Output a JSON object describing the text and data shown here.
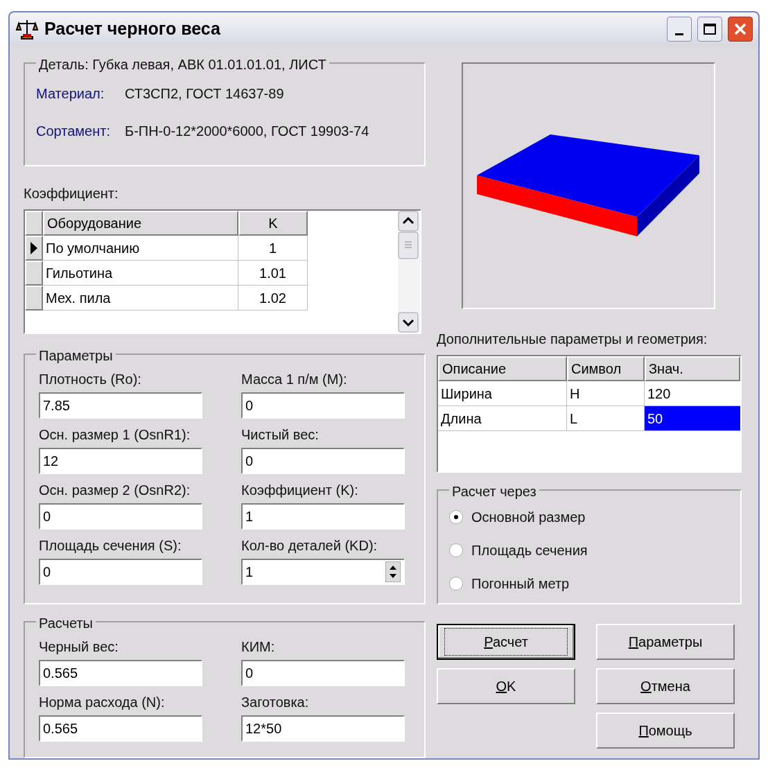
{
  "window": {
    "title": "Расчет черного веса"
  },
  "detail": {
    "legend": "Деталь: Губка левая, АВК 01.01.01.01, ЛИСТ",
    "rows": [
      {
        "label": "Материал:",
        "value": "СТ3СП2, ГОСТ 14637-89"
      },
      {
        "label": "Сортамент:",
        "value": "Б-ПН-0-12*2000*6000, ГОСТ 19903-74"
      }
    ]
  },
  "coefficient": {
    "label": "Коэффициент:",
    "columns": [
      "Оборудование",
      "K"
    ],
    "rows": [
      {
        "name": "По умолчанию",
        "k": "1",
        "selected": true
      },
      {
        "name": "Гильотина",
        "k": "1.01",
        "selected": false
      },
      {
        "name": "Мех. пила",
        "k": "1.02",
        "selected": false
      }
    ]
  },
  "parameters": {
    "legend": "Параметры",
    "fields": [
      {
        "label": "Плотность (Ro):",
        "value": "7.85",
        "kind": "text"
      },
      {
        "label": "Масса 1 п/м (M):",
        "value": "0",
        "kind": "text"
      },
      {
        "label": "Осн. размер 1 (OsnR1):",
        "value": "12",
        "kind": "text"
      },
      {
        "label": "Чистый вес:",
        "value": "0",
        "kind": "text"
      },
      {
        "label": "Осн. размер 2 (OsnR2):",
        "value": "0",
        "kind": "text"
      },
      {
        "label": "Коэффициент (K):",
        "value": "1",
        "kind": "text"
      },
      {
        "label": "Площадь сечения (S):",
        "value": "0",
        "kind": "text"
      },
      {
        "label": "Кол-во деталей (KD):",
        "value": "1",
        "kind": "spin"
      }
    ]
  },
  "calculations": {
    "legend": "Расчеты",
    "fields": [
      {
        "label": "Черный вес:",
        "value": "0.565",
        "kind": "text"
      },
      {
        "label": "КИМ:",
        "value": "0",
        "kind": "text"
      },
      {
        "label": "Норма расхода (N):",
        "value": "0.565",
        "kind": "text"
      },
      {
        "label": "Заготовка:",
        "value": "12*50",
        "kind": "text"
      }
    ]
  },
  "geometry": {
    "label": "Дополнительные параметры и геометрия:",
    "columns": [
      "Описание",
      "Символ",
      "Знач."
    ],
    "rows": [
      {
        "description": "Ширина",
        "symbol": "H",
        "value": "120",
        "selected": false
      },
      {
        "description": "Длина",
        "symbol": "L",
        "value": "50",
        "selected": true
      }
    ]
  },
  "calc_via": {
    "legend": "Расчет через",
    "options": [
      {
        "label": "Основной размер",
        "selected": true
      },
      {
        "label": "Площадь сечения",
        "selected": false
      },
      {
        "label": "Погонный метр",
        "selected": false
      }
    ]
  },
  "buttons": [
    {
      "label": "Расчет",
      "focused": true
    },
    {
      "label": "Параметры",
      "focused": false
    },
    {
      "label": "OK",
      "focused": false
    },
    {
      "label": "Отмена",
      "focused": false
    },
    {
      "label": "Помощь",
      "focused": false
    }
  ]
}
